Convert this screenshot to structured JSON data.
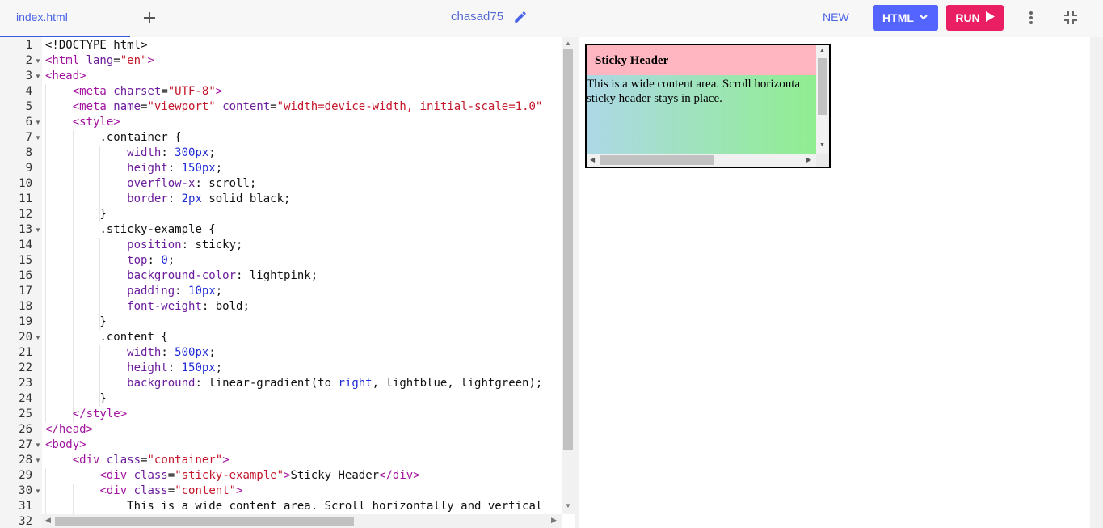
{
  "tabs": {
    "active": "index.html"
  },
  "header": {
    "project_name": "chasad75",
    "new_label": "NEW",
    "language_label": "HTML",
    "run_label": "RUN"
  },
  "colors": {
    "accent": "#5465ff",
    "run": "#e91e63",
    "tab_underline": "#3b5bdb"
  },
  "icons": {
    "new_tab": "plus-icon",
    "edit": "pencil-icon",
    "language_dropdown": "chevron-down-icon",
    "run": "play-icon",
    "more": "more-vertical-icon",
    "collapse": "collapse-icon"
  },
  "editor": {
    "folded_lines": [
      2,
      3,
      6,
      7,
      13,
      20,
      27,
      28,
      30
    ],
    "lines": [
      {
        "n": "1",
        "tokens": [
          [
            "",
            "<!DOCTYPE html>"
          ]
        ]
      },
      {
        "n": "2",
        "tokens": [
          [
            "t-tag",
            "<html "
          ],
          [
            "t-attr",
            "lang"
          ],
          [
            "",
            "="
          ],
          [
            "t-str",
            "\"en\""
          ],
          [
            "t-tag",
            ">"
          ]
        ]
      },
      {
        "n": "3",
        "tokens": [
          [
            "t-tag",
            "<head>"
          ]
        ]
      },
      {
        "n": "4",
        "tokens": [
          [
            "",
            "    "
          ],
          [
            "t-tag",
            "<meta "
          ],
          [
            "t-attr",
            "charset"
          ],
          [
            "",
            "="
          ],
          [
            "t-str",
            "\"UTF-8\""
          ],
          [
            "t-tag",
            ">"
          ]
        ]
      },
      {
        "n": "5",
        "tokens": [
          [
            "",
            "    "
          ],
          [
            "t-tag",
            "<meta "
          ],
          [
            "t-attr",
            "name"
          ],
          [
            "",
            "="
          ],
          [
            "t-str",
            "\"viewport\""
          ],
          [
            "",
            " "
          ],
          [
            "t-attr",
            "content"
          ],
          [
            "",
            "="
          ],
          [
            "t-str",
            "\"width=device-width, initial-scale=1.0\""
          ]
        ]
      },
      {
        "n": "6",
        "tokens": [
          [
            "",
            "    "
          ],
          [
            "t-tag",
            "<style>"
          ]
        ]
      },
      {
        "n": "7",
        "tokens": [
          [
            "",
            "        "
          ],
          [
            "t-sel",
            ".container {"
          ]
        ]
      },
      {
        "n": "8",
        "tokens": [
          [
            "",
            "            "
          ],
          [
            "t-prop",
            "width"
          ],
          [
            "",
            ": "
          ],
          [
            "t-num",
            "300px"
          ],
          [
            "",
            ";"
          ]
        ]
      },
      {
        "n": "9",
        "tokens": [
          [
            "",
            "            "
          ],
          [
            "t-prop",
            "height"
          ],
          [
            "",
            ": "
          ],
          [
            "t-num",
            "150px"
          ],
          [
            "",
            ";"
          ]
        ]
      },
      {
        "n": "10",
        "tokens": [
          [
            "",
            "            "
          ],
          [
            "t-prop",
            "overflow-x"
          ],
          [
            "",
            ": scroll;"
          ]
        ]
      },
      {
        "n": "11",
        "tokens": [
          [
            "",
            "            "
          ],
          [
            "t-prop",
            "border"
          ],
          [
            "",
            ": "
          ],
          [
            "t-num",
            "2px"
          ],
          [
            "",
            " solid black;"
          ]
        ]
      },
      {
        "n": "12",
        "tokens": [
          [
            "",
            "        }"
          ]
        ]
      },
      {
        "n": "13",
        "tokens": [
          [
            "",
            "        "
          ],
          [
            "t-sel",
            ".sticky-example {"
          ]
        ]
      },
      {
        "n": "14",
        "tokens": [
          [
            "",
            "            "
          ],
          [
            "t-prop",
            "position"
          ],
          [
            "",
            ": sticky;"
          ]
        ]
      },
      {
        "n": "15",
        "tokens": [
          [
            "",
            "            "
          ],
          [
            "t-prop",
            "top"
          ],
          [
            "",
            ": "
          ],
          [
            "t-num",
            "0"
          ],
          [
            "",
            ";"
          ]
        ]
      },
      {
        "n": "16",
        "tokens": [
          [
            "",
            "            "
          ],
          [
            "t-prop",
            "background-color"
          ],
          [
            "",
            ": lightpink;"
          ]
        ]
      },
      {
        "n": "17",
        "tokens": [
          [
            "",
            "            "
          ],
          [
            "t-prop",
            "padding"
          ],
          [
            "",
            ": "
          ],
          [
            "t-num",
            "10px"
          ],
          [
            "",
            ";"
          ]
        ]
      },
      {
        "n": "18",
        "tokens": [
          [
            "",
            "            "
          ],
          [
            "t-prop",
            "font-weight"
          ],
          [
            "",
            ": bold;"
          ]
        ]
      },
      {
        "n": "19",
        "tokens": [
          [
            "",
            "        }"
          ]
        ]
      },
      {
        "n": "20",
        "tokens": [
          [
            "",
            "        "
          ],
          [
            "t-sel",
            ".content {"
          ]
        ]
      },
      {
        "n": "21",
        "tokens": [
          [
            "",
            "            "
          ],
          [
            "t-prop",
            "width"
          ],
          [
            "",
            ": "
          ],
          [
            "t-num",
            "500px"
          ],
          [
            "",
            ";"
          ]
        ]
      },
      {
        "n": "22",
        "tokens": [
          [
            "",
            "            "
          ],
          [
            "t-prop",
            "height"
          ],
          [
            "",
            ": "
          ],
          [
            "t-num",
            "150px"
          ],
          [
            "",
            ";"
          ]
        ]
      },
      {
        "n": "23",
        "tokens": [
          [
            "",
            "            "
          ],
          [
            "t-prop",
            "background"
          ],
          [
            "",
            ": linear-gradient(to "
          ],
          [
            "t-kw",
            "right"
          ],
          [
            "",
            ", lightblue, lightgreen);"
          ]
        ]
      },
      {
        "n": "24",
        "tokens": [
          [
            "",
            "        }"
          ]
        ]
      },
      {
        "n": "25",
        "tokens": [
          [
            "",
            "    "
          ],
          [
            "t-tag",
            "</style>"
          ]
        ]
      },
      {
        "n": "26",
        "tokens": [
          [
            "t-tag",
            "</head>"
          ]
        ]
      },
      {
        "n": "27",
        "tokens": [
          [
            "t-tag",
            "<body>"
          ]
        ]
      },
      {
        "n": "28",
        "tokens": [
          [
            "",
            "    "
          ],
          [
            "t-tag",
            "<div "
          ],
          [
            "t-attr",
            "class"
          ],
          [
            "",
            "="
          ],
          [
            "t-str",
            "\"container\""
          ],
          [
            "t-tag",
            ">"
          ]
        ]
      },
      {
        "n": "29",
        "tokens": [
          [
            "",
            "        "
          ],
          [
            "t-tag",
            "<div "
          ],
          [
            "t-attr",
            "class"
          ],
          [
            "",
            "="
          ],
          [
            "t-str",
            "\"sticky-example\""
          ],
          [
            "t-tag",
            ">"
          ],
          [
            "",
            "Sticky Header"
          ],
          [
            "t-tag",
            "</div>"
          ]
        ]
      },
      {
        "n": "30",
        "tokens": [
          [
            "",
            "        "
          ],
          [
            "t-tag",
            "<div "
          ],
          [
            "t-attr",
            "class"
          ],
          [
            "",
            "="
          ],
          [
            "t-str",
            "\"content\""
          ],
          [
            "t-tag",
            ">"
          ]
        ]
      },
      {
        "n": "31",
        "tokens": [
          [
            "",
            "            This is a wide content area. Scroll horizontally and vertical"
          ]
        ]
      },
      {
        "n": "32",
        "tokens": [
          [
            "",
            ""
          ]
        ]
      }
    ]
  },
  "preview": {
    "sticky_header": "Sticky Header",
    "content_text": "This is a wide content area. Scroll horizonta\nsticky header stays in place."
  }
}
